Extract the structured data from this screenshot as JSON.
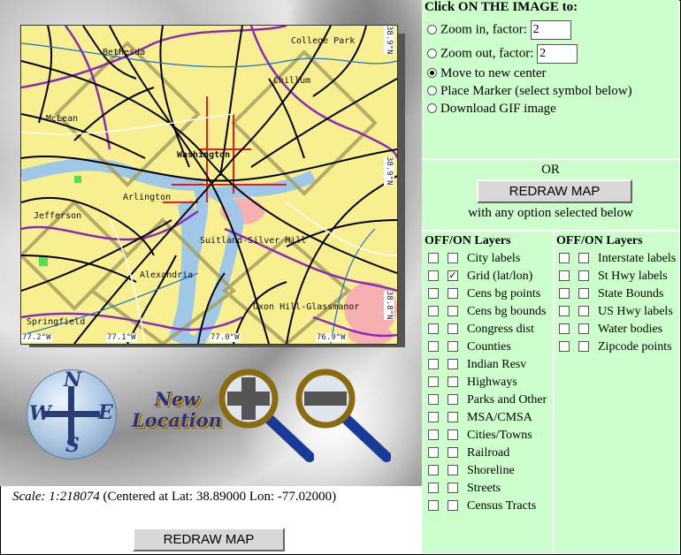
{
  "map": {
    "places": {
      "bethesda": "Bethesda",
      "college_park": "College Park",
      "chillum": "Chillum",
      "mclean": "McLean",
      "washington": "Washington",
      "arlington": "Arlington",
      "jefferson": "Jefferson",
      "suitland": "Suitland-Silver Hill",
      "alexandria": "Alexandria",
      "springfield": "Springfield",
      "oxon_hill": "Oxon Hill-Glassmanor"
    },
    "lat_ticks": [
      "38.9°N",
      "38.9°N",
      "38.8°N"
    ],
    "lon_ticks": [
      "77.2°W",
      "77.1°W",
      "77.0°W",
      "76.9°W"
    ],
    "colors": {
      "land": "#f7ef90",
      "water": "#9fc7e8",
      "roads": "#000000",
      "grid": "#a8a060"
    }
  },
  "nav": {
    "compass": {
      "n": "N",
      "s": "S",
      "e": "E",
      "w": "W"
    },
    "new_location": "New Location"
  },
  "scale": {
    "label": "Scale: 1:218074",
    "center": "(Centered at Lat: 38.89000 Lon: -77.02000)"
  },
  "bottom_button": "REDRAW MAP",
  "panel": {
    "title": "Click ON THE IMAGE to:",
    "options": [
      {
        "label": "Zoom in, factor:",
        "value": "2",
        "selected": false
      },
      {
        "label": "Zoom out, factor:",
        "value": "2",
        "selected": false
      },
      {
        "label": "Move to new center",
        "selected": true
      },
      {
        "label": "Place Marker (select symbol below)",
        "selected": false
      },
      {
        "label": "Download GIF image",
        "selected": false
      }
    ],
    "or": "OR",
    "redraw_button": "REDRAW MAP",
    "with_any": "with any option selected below"
  },
  "layers_left": {
    "heading": "OFF/ON Layers",
    "items": [
      {
        "label": "City labels",
        "on": false
      },
      {
        "label": "Grid (lat/lon)",
        "on": true
      },
      {
        "label": "Cens bg points",
        "on": false
      },
      {
        "label": "Cens bg bounds",
        "on": false
      },
      {
        "label": "Congress dist",
        "on": false
      },
      {
        "label": "Counties",
        "on": false
      },
      {
        "label": "Indian Resv",
        "on": false
      },
      {
        "label": "Highways",
        "on": false
      },
      {
        "label": "Parks and Other",
        "on": false
      },
      {
        "label": "MSA/CMSA",
        "on": false
      },
      {
        "label": "Cities/Towns",
        "on": false
      },
      {
        "label": "Railroad",
        "on": false
      },
      {
        "label": "Shoreline",
        "on": false
      },
      {
        "label": "Streets",
        "on": false
      },
      {
        "label": "Census Tracts",
        "on": false
      }
    ]
  },
  "layers_right": {
    "heading": "OFF/ON Layers",
    "items": [
      {
        "label": "Interstate labels",
        "on": false
      },
      {
        "label": "St Hwy labels",
        "on": false
      },
      {
        "label": "State Bounds",
        "on": false
      },
      {
        "label": "US Hwy labels",
        "on": false
      },
      {
        "label": "Water bodies",
        "on": false
      },
      {
        "label": "Zipcode points",
        "on": false
      }
    ]
  }
}
